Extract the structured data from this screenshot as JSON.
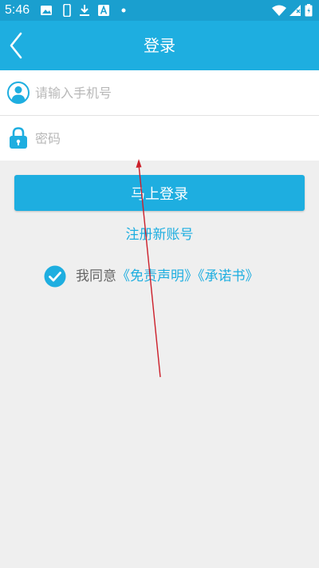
{
  "status_bar": {
    "time": "5:46",
    "icons": [
      "image-icon",
      "phone-icon",
      "download-icon",
      "font-icon",
      "dot-icon",
      "wifi-icon",
      "signal-icon",
      "battery-icon"
    ]
  },
  "app_bar": {
    "title": "登录",
    "back_icon": "chevron-left-icon"
  },
  "form": {
    "phone_placeholder": "请输入手机号",
    "phone_value": "",
    "password_placeholder": "密码",
    "password_value": "",
    "phone_icon": "user-icon",
    "password_icon": "lock-icon"
  },
  "login_button_label": "马上登录",
  "register_link": "注册新账号",
  "agreement": {
    "prefix": "我同意",
    "disclaimer": "《免责声明》",
    "commitment": "《承诺书》",
    "checked": true
  },
  "colors": {
    "status_bar": "#1a9fcf",
    "accent": "#1eaee0",
    "background": "#efefef",
    "annotation": "#cc1f2a"
  }
}
